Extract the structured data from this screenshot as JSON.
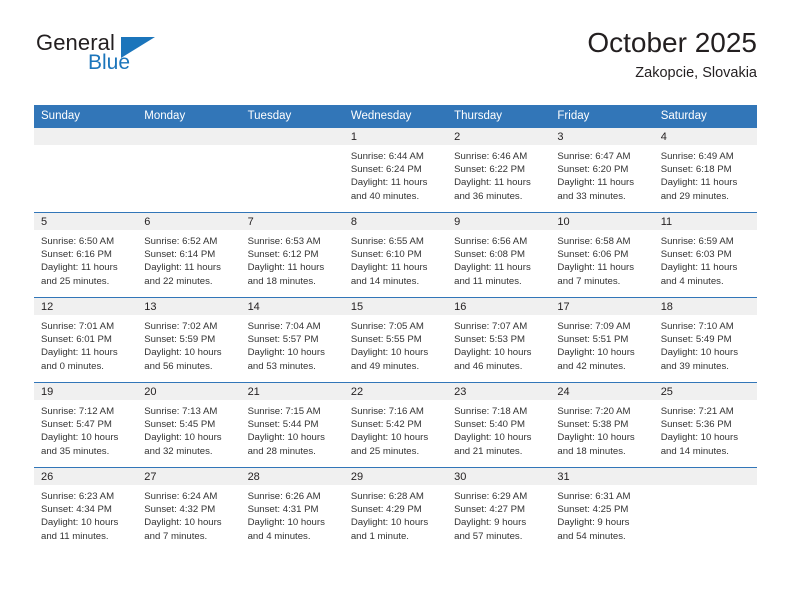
{
  "brand": {
    "name_top": "General",
    "name_bottom": "Blue",
    "accent_color": "#1b75bb"
  },
  "header": {
    "title": "October 2025",
    "subtitle": "Zakopcie, Slovakia"
  },
  "theme": {
    "header_blue": "#3276b8",
    "daynum_band": "#f0f0f0",
    "text": "#231f20",
    "cell_text": "#333333"
  },
  "calendar": {
    "weekday_headers": [
      "Sunday",
      "Monday",
      "Tuesday",
      "Wednesday",
      "Thursday",
      "Friday",
      "Saturday"
    ],
    "weeks": [
      [
        {
          "day": "",
          "empty": true,
          "sunrise": "",
          "sunset": "",
          "daylight_line1": "",
          "daylight_line2": ""
        },
        {
          "day": "",
          "empty": true,
          "sunrise": "",
          "sunset": "",
          "daylight_line1": "",
          "daylight_line2": ""
        },
        {
          "day": "",
          "empty": true,
          "sunrise": "",
          "sunset": "",
          "daylight_line1": "",
          "daylight_line2": ""
        },
        {
          "day": "1",
          "empty": false,
          "sunrise": "Sunrise: 6:44 AM",
          "sunset": "Sunset: 6:24 PM",
          "daylight_line1": "Daylight: 11 hours",
          "daylight_line2": "and 40 minutes."
        },
        {
          "day": "2",
          "empty": false,
          "sunrise": "Sunrise: 6:46 AM",
          "sunset": "Sunset: 6:22 PM",
          "daylight_line1": "Daylight: 11 hours",
          "daylight_line2": "and 36 minutes."
        },
        {
          "day": "3",
          "empty": false,
          "sunrise": "Sunrise: 6:47 AM",
          "sunset": "Sunset: 6:20 PM",
          "daylight_line1": "Daylight: 11 hours",
          "daylight_line2": "and 33 minutes."
        },
        {
          "day": "4",
          "empty": false,
          "sunrise": "Sunrise: 6:49 AM",
          "sunset": "Sunset: 6:18 PM",
          "daylight_line1": "Daylight: 11 hours",
          "daylight_line2": "and 29 minutes."
        }
      ],
      [
        {
          "day": "5",
          "empty": false,
          "sunrise": "Sunrise: 6:50 AM",
          "sunset": "Sunset: 6:16 PM",
          "daylight_line1": "Daylight: 11 hours",
          "daylight_line2": "and 25 minutes."
        },
        {
          "day": "6",
          "empty": false,
          "sunrise": "Sunrise: 6:52 AM",
          "sunset": "Sunset: 6:14 PM",
          "daylight_line1": "Daylight: 11 hours",
          "daylight_line2": "and 22 minutes."
        },
        {
          "day": "7",
          "empty": false,
          "sunrise": "Sunrise: 6:53 AM",
          "sunset": "Sunset: 6:12 PM",
          "daylight_line1": "Daylight: 11 hours",
          "daylight_line2": "and 18 minutes."
        },
        {
          "day": "8",
          "empty": false,
          "sunrise": "Sunrise: 6:55 AM",
          "sunset": "Sunset: 6:10 PM",
          "daylight_line1": "Daylight: 11 hours",
          "daylight_line2": "and 14 minutes."
        },
        {
          "day": "9",
          "empty": false,
          "sunrise": "Sunrise: 6:56 AM",
          "sunset": "Sunset: 6:08 PM",
          "daylight_line1": "Daylight: 11 hours",
          "daylight_line2": "and 11 minutes."
        },
        {
          "day": "10",
          "empty": false,
          "sunrise": "Sunrise: 6:58 AM",
          "sunset": "Sunset: 6:06 PM",
          "daylight_line1": "Daylight: 11 hours",
          "daylight_line2": "and 7 minutes."
        },
        {
          "day": "11",
          "empty": false,
          "sunrise": "Sunrise: 6:59 AM",
          "sunset": "Sunset: 6:03 PM",
          "daylight_line1": "Daylight: 11 hours",
          "daylight_line2": "and 4 minutes."
        }
      ],
      [
        {
          "day": "12",
          "empty": false,
          "sunrise": "Sunrise: 7:01 AM",
          "sunset": "Sunset: 6:01 PM",
          "daylight_line1": "Daylight: 11 hours",
          "daylight_line2": "and 0 minutes."
        },
        {
          "day": "13",
          "empty": false,
          "sunrise": "Sunrise: 7:02 AM",
          "sunset": "Sunset: 5:59 PM",
          "daylight_line1": "Daylight: 10 hours",
          "daylight_line2": "and 56 minutes."
        },
        {
          "day": "14",
          "empty": false,
          "sunrise": "Sunrise: 7:04 AM",
          "sunset": "Sunset: 5:57 PM",
          "daylight_line1": "Daylight: 10 hours",
          "daylight_line2": "and 53 minutes."
        },
        {
          "day": "15",
          "empty": false,
          "sunrise": "Sunrise: 7:05 AM",
          "sunset": "Sunset: 5:55 PM",
          "daylight_line1": "Daylight: 10 hours",
          "daylight_line2": "and 49 minutes."
        },
        {
          "day": "16",
          "empty": false,
          "sunrise": "Sunrise: 7:07 AM",
          "sunset": "Sunset: 5:53 PM",
          "daylight_line1": "Daylight: 10 hours",
          "daylight_line2": "and 46 minutes."
        },
        {
          "day": "17",
          "empty": false,
          "sunrise": "Sunrise: 7:09 AM",
          "sunset": "Sunset: 5:51 PM",
          "daylight_line1": "Daylight: 10 hours",
          "daylight_line2": "and 42 minutes."
        },
        {
          "day": "18",
          "empty": false,
          "sunrise": "Sunrise: 7:10 AM",
          "sunset": "Sunset: 5:49 PM",
          "daylight_line1": "Daylight: 10 hours",
          "daylight_line2": "and 39 minutes."
        }
      ],
      [
        {
          "day": "19",
          "empty": false,
          "sunrise": "Sunrise: 7:12 AM",
          "sunset": "Sunset: 5:47 PM",
          "daylight_line1": "Daylight: 10 hours",
          "daylight_line2": "and 35 minutes."
        },
        {
          "day": "20",
          "empty": false,
          "sunrise": "Sunrise: 7:13 AM",
          "sunset": "Sunset: 5:45 PM",
          "daylight_line1": "Daylight: 10 hours",
          "daylight_line2": "and 32 minutes."
        },
        {
          "day": "21",
          "empty": false,
          "sunrise": "Sunrise: 7:15 AM",
          "sunset": "Sunset: 5:44 PM",
          "daylight_line1": "Daylight: 10 hours",
          "daylight_line2": "and 28 minutes."
        },
        {
          "day": "22",
          "empty": false,
          "sunrise": "Sunrise: 7:16 AM",
          "sunset": "Sunset: 5:42 PM",
          "daylight_line1": "Daylight: 10 hours",
          "daylight_line2": "and 25 minutes."
        },
        {
          "day": "23",
          "empty": false,
          "sunrise": "Sunrise: 7:18 AM",
          "sunset": "Sunset: 5:40 PM",
          "daylight_line1": "Daylight: 10 hours",
          "daylight_line2": "and 21 minutes."
        },
        {
          "day": "24",
          "empty": false,
          "sunrise": "Sunrise: 7:20 AM",
          "sunset": "Sunset: 5:38 PM",
          "daylight_line1": "Daylight: 10 hours",
          "daylight_line2": "and 18 minutes."
        },
        {
          "day": "25",
          "empty": false,
          "sunrise": "Sunrise: 7:21 AM",
          "sunset": "Sunset: 5:36 PM",
          "daylight_line1": "Daylight: 10 hours",
          "daylight_line2": "and 14 minutes."
        }
      ],
      [
        {
          "day": "26",
          "empty": false,
          "sunrise": "Sunrise: 6:23 AM",
          "sunset": "Sunset: 4:34 PM",
          "daylight_line1": "Daylight: 10 hours",
          "daylight_line2": "and 11 minutes."
        },
        {
          "day": "27",
          "empty": false,
          "sunrise": "Sunrise: 6:24 AM",
          "sunset": "Sunset: 4:32 PM",
          "daylight_line1": "Daylight: 10 hours",
          "daylight_line2": "and 7 minutes."
        },
        {
          "day": "28",
          "empty": false,
          "sunrise": "Sunrise: 6:26 AM",
          "sunset": "Sunset: 4:31 PM",
          "daylight_line1": "Daylight: 10 hours",
          "daylight_line2": "and 4 minutes."
        },
        {
          "day": "29",
          "empty": false,
          "sunrise": "Sunrise: 6:28 AM",
          "sunset": "Sunset: 4:29 PM",
          "daylight_line1": "Daylight: 10 hours",
          "daylight_line2": "and 1 minute."
        },
        {
          "day": "30",
          "empty": false,
          "sunrise": "Sunrise: 6:29 AM",
          "sunset": "Sunset: 4:27 PM",
          "daylight_line1": "Daylight: 9 hours",
          "daylight_line2": "and 57 minutes."
        },
        {
          "day": "31",
          "empty": false,
          "sunrise": "Sunrise: 6:31 AM",
          "sunset": "Sunset: 4:25 PM",
          "daylight_line1": "Daylight: 9 hours",
          "daylight_line2": "and 54 minutes."
        },
        {
          "day": "",
          "empty": true,
          "sunrise": "",
          "sunset": "",
          "daylight_line1": "",
          "daylight_line2": ""
        }
      ]
    ]
  }
}
